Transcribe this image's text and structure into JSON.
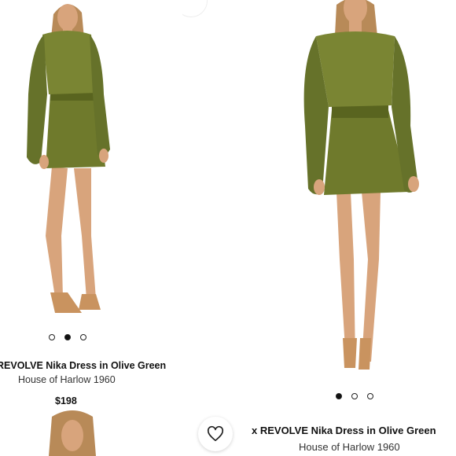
{
  "left_product": {
    "title": "REVOLVE Nika Dress in Olive Green",
    "brand": "House of Harlow 1960",
    "price": "$198",
    "carousel": {
      "count": 3,
      "active": 2
    },
    "image_icon": "model-photo"
  },
  "right_product": {
    "title": "x REVOLVE Nika Dress in Olive Green",
    "brand": "House of Harlow 1960",
    "carousel": {
      "count": 3,
      "active": 1
    },
    "image_icon": "model-photo",
    "favorite_icon": "heart-icon"
  },
  "colors": {
    "dress": "#6f7a2c",
    "dress_dark": "#4f5a1c",
    "skin": "#d8a47c",
    "hair": "#b88a58",
    "background": "#ffffff"
  }
}
